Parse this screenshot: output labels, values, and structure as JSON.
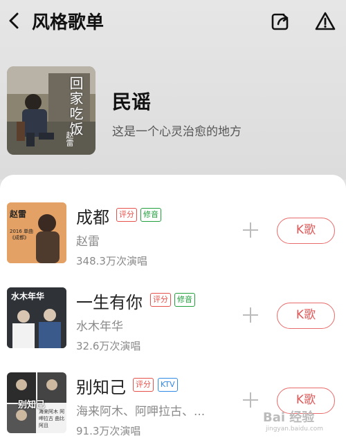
{
  "header": {
    "title": "风格歌单",
    "back_icon": "chevron-left-icon",
    "share_icon": "share-icon",
    "report_icon": "warning-icon"
  },
  "playlist": {
    "name": "民谣",
    "description": "这是一个心灵治愈的地方",
    "cover_title": "回家吃饭",
    "cover_artist": "赵雷"
  },
  "songs": [
    {
      "title": "成都",
      "tags": [
        "评分",
        "修音"
      ],
      "artist": "赵雷",
      "plays": "348.3万次演唱",
      "thumb_text": "赵雷",
      "thumb_subtext": "2016 单曲《成都》",
      "k_label": "K歌"
    },
    {
      "title": "一生有你",
      "tags": [
        "评分",
        "修音"
      ],
      "artist": "水木年华",
      "plays": "32.6万次演唱",
      "thumb_text": "水木年华",
      "k_label": "K歌"
    },
    {
      "title": "别知己",
      "tags": [
        "评分",
        "KTV"
      ],
      "artist": "海来阿木、阿呷拉古、...",
      "plays": "91.3万次演唱",
      "thumb_text": "别知己",
      "thumb_subtext": "海来阿木 阿呷拉古 曲比阿且",
      "k_label": "K歌"
    }
  ],
  "watermark": {
    "text": "Bai 经验",
    "subtext": "jingyan.baidu.com"
  },
  "colors": {
    "accent": "#e96a6a",
    "tag_red": "#e6504a",
    "tag_green": "#1f9e3a",
    "tag_blue": "#2e8ae6"
  }
}
